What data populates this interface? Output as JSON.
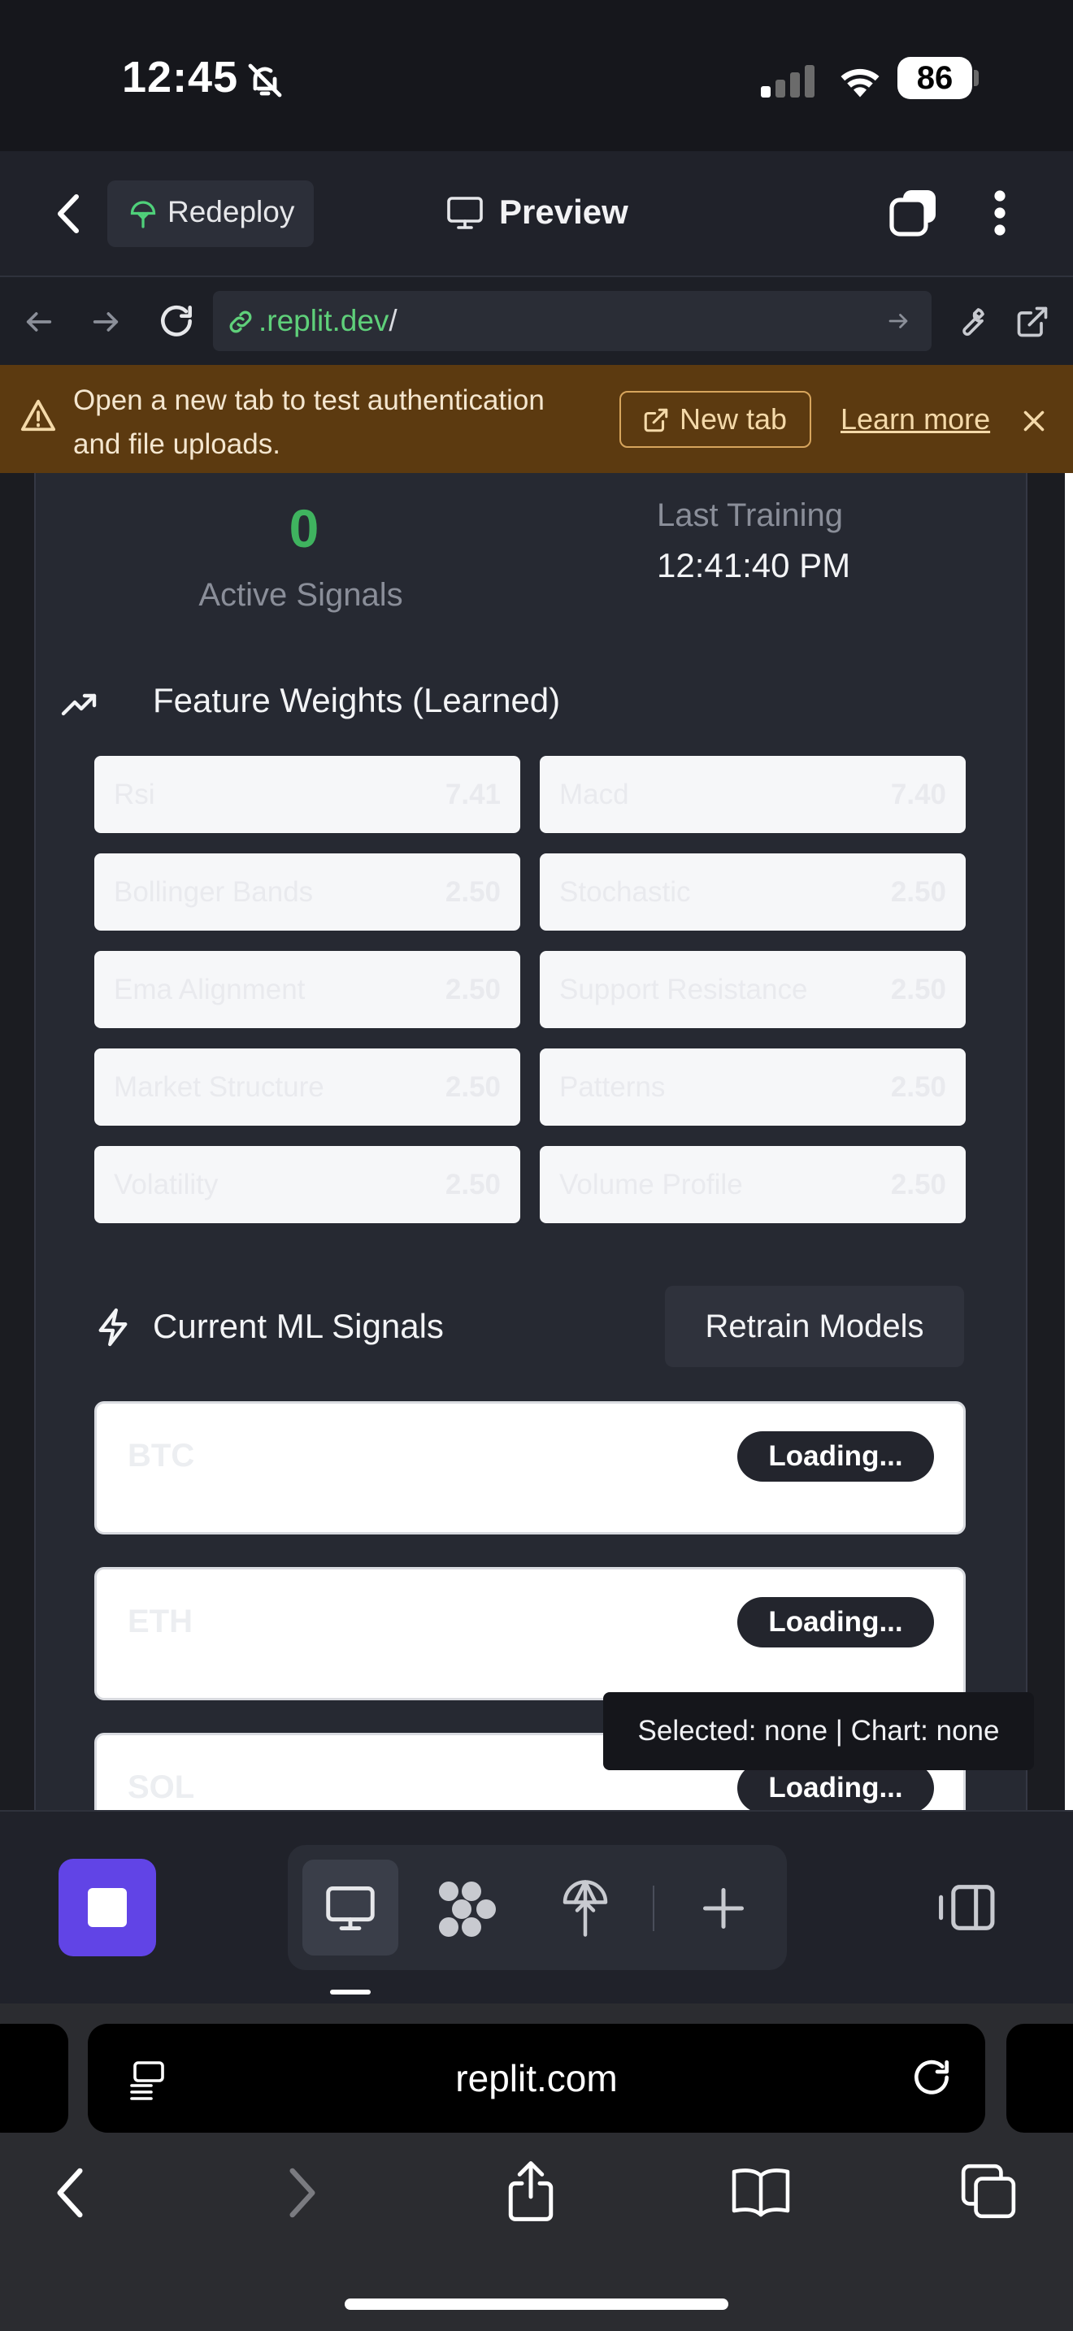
{
  "status_bar": {
    "time": "12:45",
    "battery": "86"
  },
  "header": {
    "redeploy_label": "Redeploy",
    "preview_label": "Preview"
  },
  "urlbar": {
    "url_host": ".replit.dev",
    "url_path": "/"
  },
  "banner": {
    "message": "Open a new tab to test authentication and file uploads.",
    "new_tab_label": "New tab",
    "learn_more_label": "Learn more"
  },
  "app": {
    "stats": {
      "active_signals_value": "0",
      "active_signals_label": "Active Signals",
      "last_training_label": "Last Training",
      "last_training_value": "12:41:40 PM"
    },
    "weights_title": "Feature Weights (Learned)",
    "weights": [
      {
        "name": "Rsi",
        "value": "7.41"
      },
      {
        "name": "Macd",
        "value": "7.40"
      },
      {
        "name": "Bollinger Bands",
        "value": "2.50"
      },
      {
        "name": "Stochastic",
        "value": "2.50"
      },
      {
        "name": "Ema Alignment",
        "value": "2.50"
      },
      {
        "name": "Support Resistance",
        "value": "2.50"
      },
      {
        "name": "Market Structure",
        "value": "2.50"
      },
      {
        "name": "Patterns",
        "value": "2.50"
      },
      {
        "name": "Volatility",
        "value": "2.50"
      },
      {
        "name": "Volume Profile",
        "value": "2.50"
      }
    ],
    "signals_title": "Current ML Signals",
    "retrain_label": "Retrain Models",
    "signals": [
      {
        "symbol": "BTC",
        "status": "Loading..."
      },
      {
        "symbol": "ETH",
        "status": "Loading..."
      },
      {
        "symbol": "SOL",
        "status": "Loading..."
      }
    ],
    "tooltip": "Selected: none | Chart: none"
  },
  "safari": {
    "domain": "replit.com"
  },
  "colors": {
    "accent_purple": "#6144e6",
    "success_green": "#3fb35f",
    "url_green": "#5fd07a",
    "banner_bg": "#5c3a10"
  }
}
